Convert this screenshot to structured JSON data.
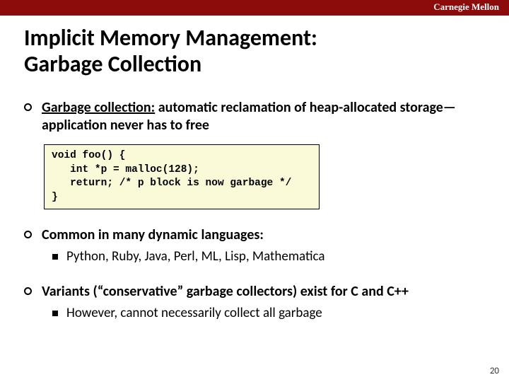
{
  "brand": "Carnegie Mellon",
  "title_line1": "Implicit Memory Management:",
  "title_line2": "Garbage Collection",
  "bullets": [
    {
      "term": "Garbage collection:",
      "rest": " automatic reclamation of heap-allocated storage—application never has to free",
      "code": "void foo() {\n   int *p = malloc(128);\n   return; /* p block is now garbage */\n}"
    },
    {
      "text": "Common in many dynamic languages:",
      "sub": [
        "Python, Ruby, Java, Perl, ML, Lisp, Mathematica"
      ]
    },
    {
      "text": "Variants (“conservative” garbage collectors) exist for C and C++",
      "sub": [
        "However, cannot necessarily collect all garbage"
      ]
    }
  ],
  "page_number": "20"
}
